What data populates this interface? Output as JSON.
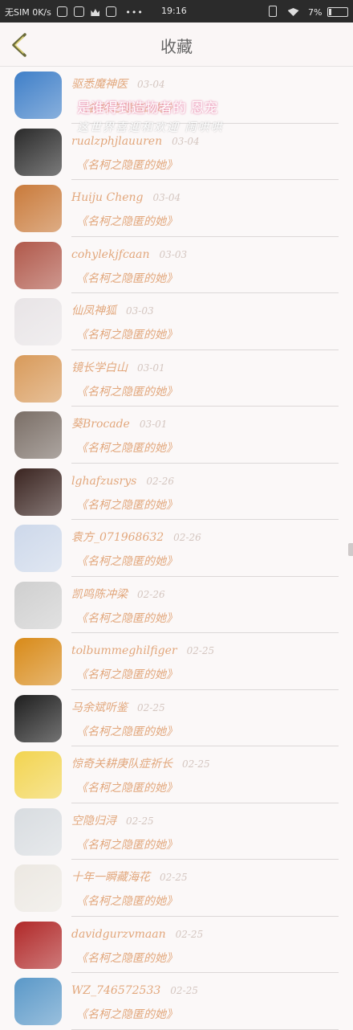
{
  "status_bar": {
    "carrier": "无SIM 0K/s",
    "time": "19:16",
    "battery": "7%"
  },
  "header": {
    "title": "收藏",
    "back_icon": "chevron-left-icon"
  },
  "overlay": {
    "line1": "是谁得到造物者的 恩宠",
    "line2": "这世界喜迎和欢迎 闹哄哄"
  },
  "favorites": [
    {
      "name": "驱悉魔神医",
      "date": "03-04",
      "work": "《名柯之隐匿的她》",
      "avatar_color": "#3f7fc8"
    },
    {
      "name": "rualzphjlauuren",
      "date": "03-04",
      "work": "《名柯之隐匿的她》",
      "avatar_color": "#2a2a2a"
    },
    {
      "name": "Huiju Cheng",
      "date": "03-04",
      "work": "《名柯之隐匿的她》",
      "avatar_color": "#c97a3a"
    },
    {
      "name": "cohylekjfcaan",
      "date": "03-03",
      "work": "《名柯之隐匿的她》",
      "avatar_color": "#b0584a"
    },
    {
      "name": "仙凤神狐",
      "date": "03-03",
      "work": "《名柯之隐匿的她》",
      "avatar_color": "#e8e4e6"
    },
    {
      "name": "镜长学白山",
      "date": "03-01",
      "work": "《名柯之隐匿的她》",
      "avatar_color": "#d89a5a"
    },
    {
      "name": "葵Brocade",
      "date": "03-01",
      "work": "《名柯之隐匿的她》",
      "avatar_color": "#7a6e66"
    },
    {
      "name": "lghafzusrys",
      "date": "02-26",
      "work": "《名柯之隐匿的她》",
      "avatar_color": "#3a2420"
    },
    {
      "name": "袁方_071968632",
      "date": "02-26",
      "work": "《名柯之隐匿的她》",
      "avatar_color": "#cdd8ea"
    },
    {
      "name": "凯鸣陈冲梁",
      "date": "02-26",
      "work": "《名柯之隐匿的她》",
      "avatar_color": "#cfcfcf"
    },
    {
      "name": "tolbummeghilfiger",
      "date": "02-25",
      "work": "《名柯之隐匿的她》",
      "avatar_color": "#d88a18"
    },
    {
      "name": "马余斌听鉴",
      "date": "02-25",
      "work": "《名柯之隐匿的她》",
      "avatar_color": "#1e1e1e"
    },
    {
      "name": "惊奇关耕庚队症祈长",
      "date": "02-25",
      "work": "《名柯之隐匿的她》",
      "avatar_color": "#f2d450"
    },
    {
      "name": "空隐归浔",
      "date": "02-25",
      "work": "《名柯之隐匿的她》",
      "avatar_color": "#d8dce0"
    },
    {
      "name": "十年一瞬藏海花",
      "date": "02-25",
      "work": "《名柯之隐匿的她》",
      "avatar_color": "#ece8e2"
    },
    {
      "name": "davidgurzvmaan",
      "date": "02-25",
      "work": "《名柯之隐匿的她》",
      "avatar_color": "#b02828"
    },
    {
      "name": "WZ_746572533",
      "date": "02-25",
      "work": "《名柯之隐匿的她》",
      "avatar_color": "#5a98c8"
    }
  ]
}
